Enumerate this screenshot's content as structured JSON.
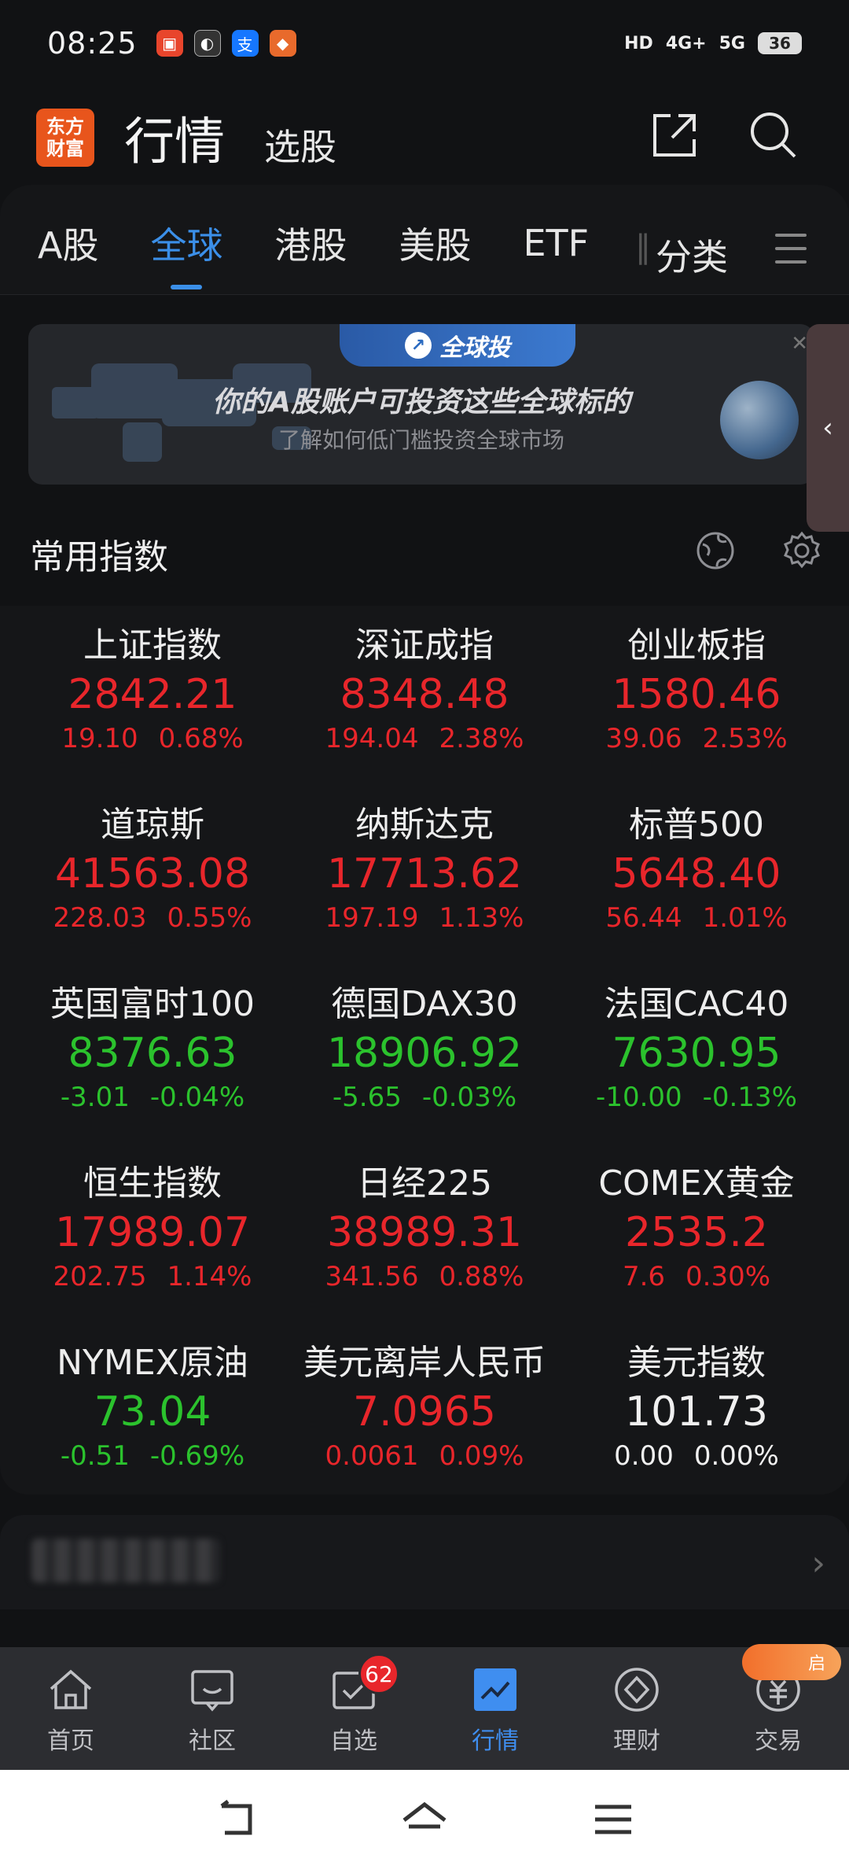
{
  "status_bar": {
    "time": "08:25",
    "network_hd": "HD",
    "network_4g": "4G+",
    "network_5g": "5G",
    "battery": "36"
  },
  "header": {
    "logo_text": "东方财富",
    "title": "行情",
    "subnav": "选股"
  },
  "tabs": [
    {
      "label": "A股",
      "active": false
    },
    {
      "label": "全球",
      "active": true
    },
    {
      "label": "港股",
      "active": false
    },
    {
      "label": "美股",
      "active": false
    },
    {
      "label": "ETF",
      "active": false
    }
  ],
  "tab_category": "分类",
  "banner": {
    "badge": "全球投",
    "headline": "你的A股账户可投资这些全球标的",
    "subtitle": "了解如何低门槛投资全球市场"
  },
  "section": {
    "title": "常用指数"
  },
  "indices": [
    {
      "name": "上证指数",
      "price": "2842.21",
      "change": "19.10",
      "pct": "0.68%",
      "trend": "up"
    },
    {
      "name": "深证成指",
      "price": "8348.48",
      "change": "194.04",
      "pct": "2.38%",
      "trend": "up"
    },
    {
      "name": "创业板指",
      "price": "1580.46",
      "change": "39.06",
      "pct": "2.53%",
      "trend": "up"
    },
    {
      "name": "道琼斯",
      "price": "41563.08",
      "change": "228.03",
      "pct": "0.55%",
      "trend": "up"
    },
    {
      "name": "纳斯达克",
      "price": "17713.62",
      "change": "197.19",
      "pct": "1.13%",
      "trend": "up"
    },
    {
      "name": "标普500",
      "price": "5648.40",
      "change": "56.44",
      "pct": "1.01%",
      "trend": "up"
    },
    {
      "name": "英国富时100",
      "price": "8376.63",
      "change": "-3.01",
      "pct": "-0.04%",
      "trend": "down"
    },
    {
      "name": "德国DAX30",
      "price": "18906.92",
      "change": "-5.65",
      "pct": "-0.03%",
      "trend": "down"
    },
    {
      "name": "法国CAC40",
      "price": "7630.95",
      "change": "-10.00",
      "pct": "-0.13%",
      "trend": "down"
    },
    {
      "name": "恒生指数",
      "price": "17989.07",
      "change": "202.75",
      "pct": "1.14%",
      "trend": "up"
    },
    {
      "name": "日经225",
      "price": "38989.31",
      "change": "341.56",
      "pct": "0.88%",
      "trend": "up"
    },
    {
      "name": "COMEX黄金",
      "price": "2535.2",
      "change": "7.6",
      "pct": "0.30%",
      "trend": "up"
    },
    {
      "name": "NYMEX原油",
      "price": "73.04",
      "change": "-0.51",
      "pct": "-0.69%",
      "trend": "down"
    },
    {
      "name": "美元离岸人民币",
      "price": "7.0965",
      "change": "0.0061",
      "pct": "0.09%",
      "trend": "up"
    },
    {
      "name": "美元指数",
      "price": "101.73",
      "change": "0.00",
      "pct": "0.00%",
      "trend": "flat"
    }
  ],
  "bottom_nav": [
    {
      "label": "首页",
      "icon": "home-icon",
      "active": false
    },
    {
      "label": "社区",
      "icon": "community-icon",
      "active": false
    },
    {
      "label": "自选",
      "icon": "watchlist-icon",
      "active": false,
      "badge": "62"
    },
    {
      "label": "行情",
      "icon": "market-icon",
      "active": true
    },
    {
      "label": "理财",
      "icon": "wealth-icon",
      "active": false
    },
    {
      "label": "交易",
      "icon": "trade-icon",
      "active": false
    }
  ],
  "promo_pill": "启",
  "colors": {
    "up": "#e8262b",
    "down": "#2bc22d",
    "accent": "#3b8fe8",
    "brand": "#e8551c"
  }
}
